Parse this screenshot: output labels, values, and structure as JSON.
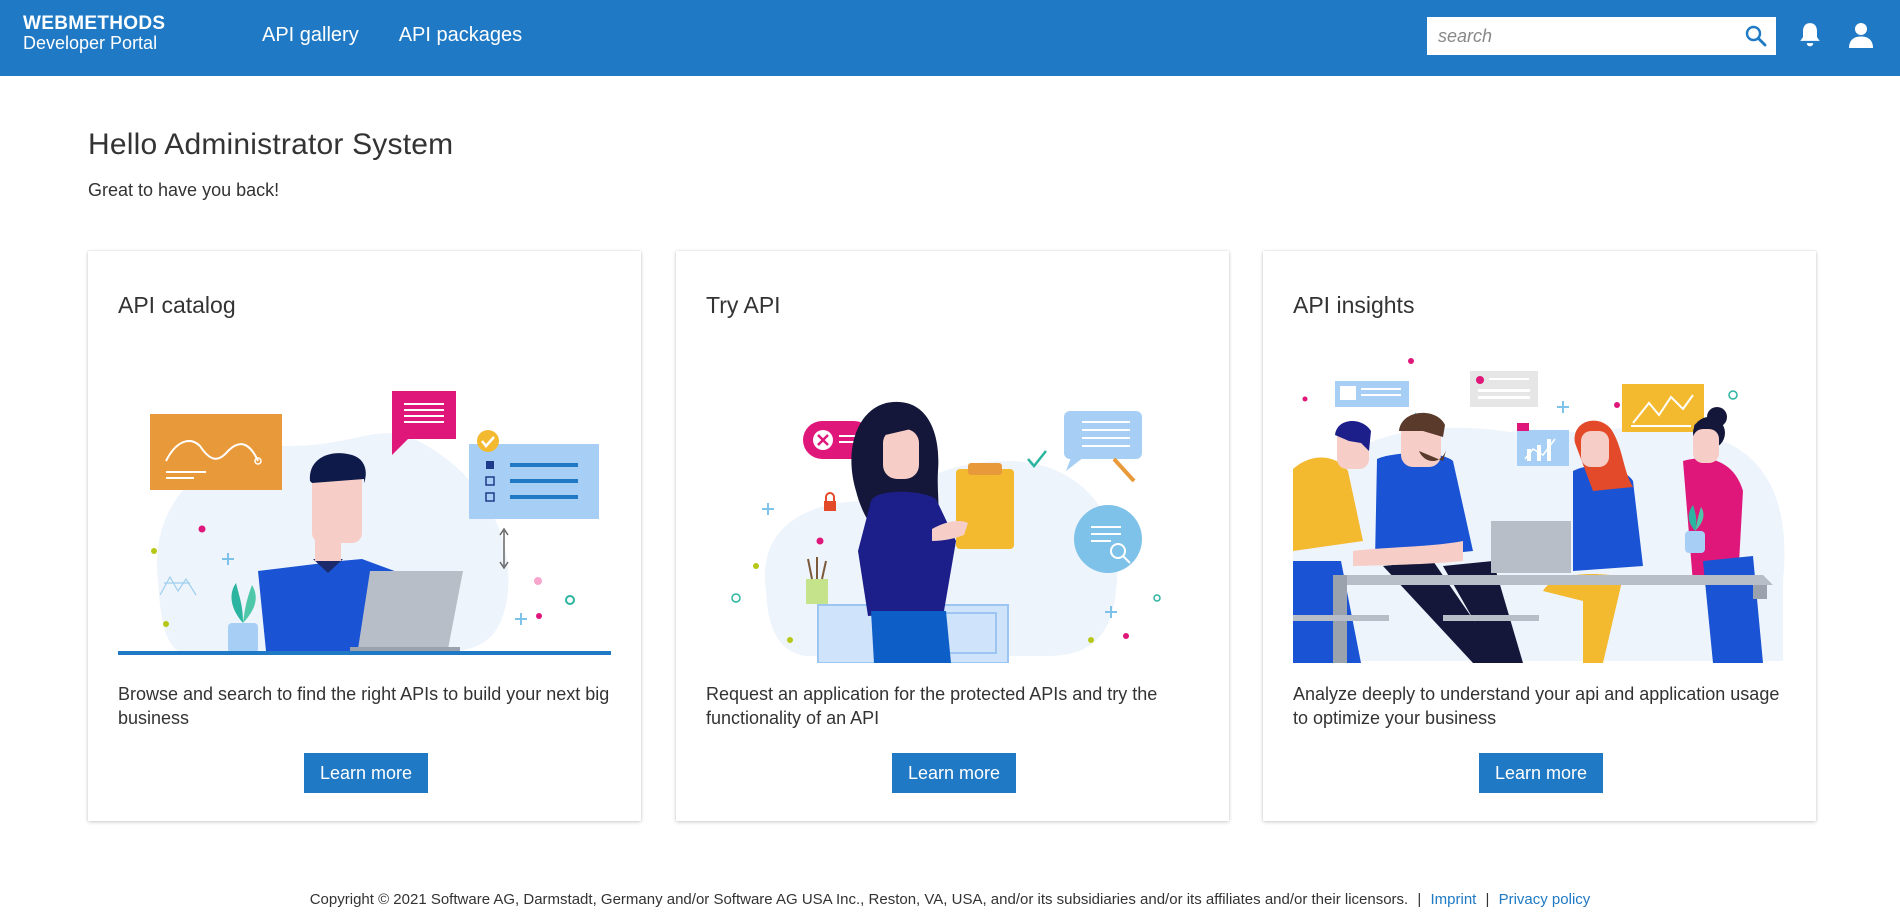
{
  "header": {
    "brand": "WEBMETHODS",
    "subtitle": "Developer Portal",
    "nav": [
      {
        "label": "API gallery"
      },
      {
        "label": "API packages"
      }
    ],
    "search_placeholder": "search",
    "search_icon": "search-icon",
    "bell_icon": "bell-icon",
    "user_icon": "user-icon"
  },
  "main": {
    "greeting": "Hello Administrator System",
    "greeting_sub": "Great to have you back!",
    "cards": [
      {
        "title": "API catalog",
        "description": "Browse and search to find the right APIs to build your next big business",
        "button": "Learn more"
      },
      {
        "title": "Try API",
        "description": "Request an application for the protected APIs and try the functionality of an API",
        "button": "Learn more"
      },
      {
        "title": "API insights",
        "description": "Analyze deeply to understand your api and application usage to optimize your business",
        "button": "Learn more"
      }
    ]
  },
  "footer": {
    "copyright": "Copyright © 2021 Software AG, Darmstadt, Germany and/or Software AG USA Inc., Reston, VA, USA, and/or its subsidiaries and/or its affiliates and/or their licensors.",
    "imprint": "Imprint",
    "privacy": "Privacy policy"
  },
  "colors": {
    "header_bg": "#1f79c4",
    "button_bg": "#1f79c4",
    "link": "#1f79c4"
  }
}
